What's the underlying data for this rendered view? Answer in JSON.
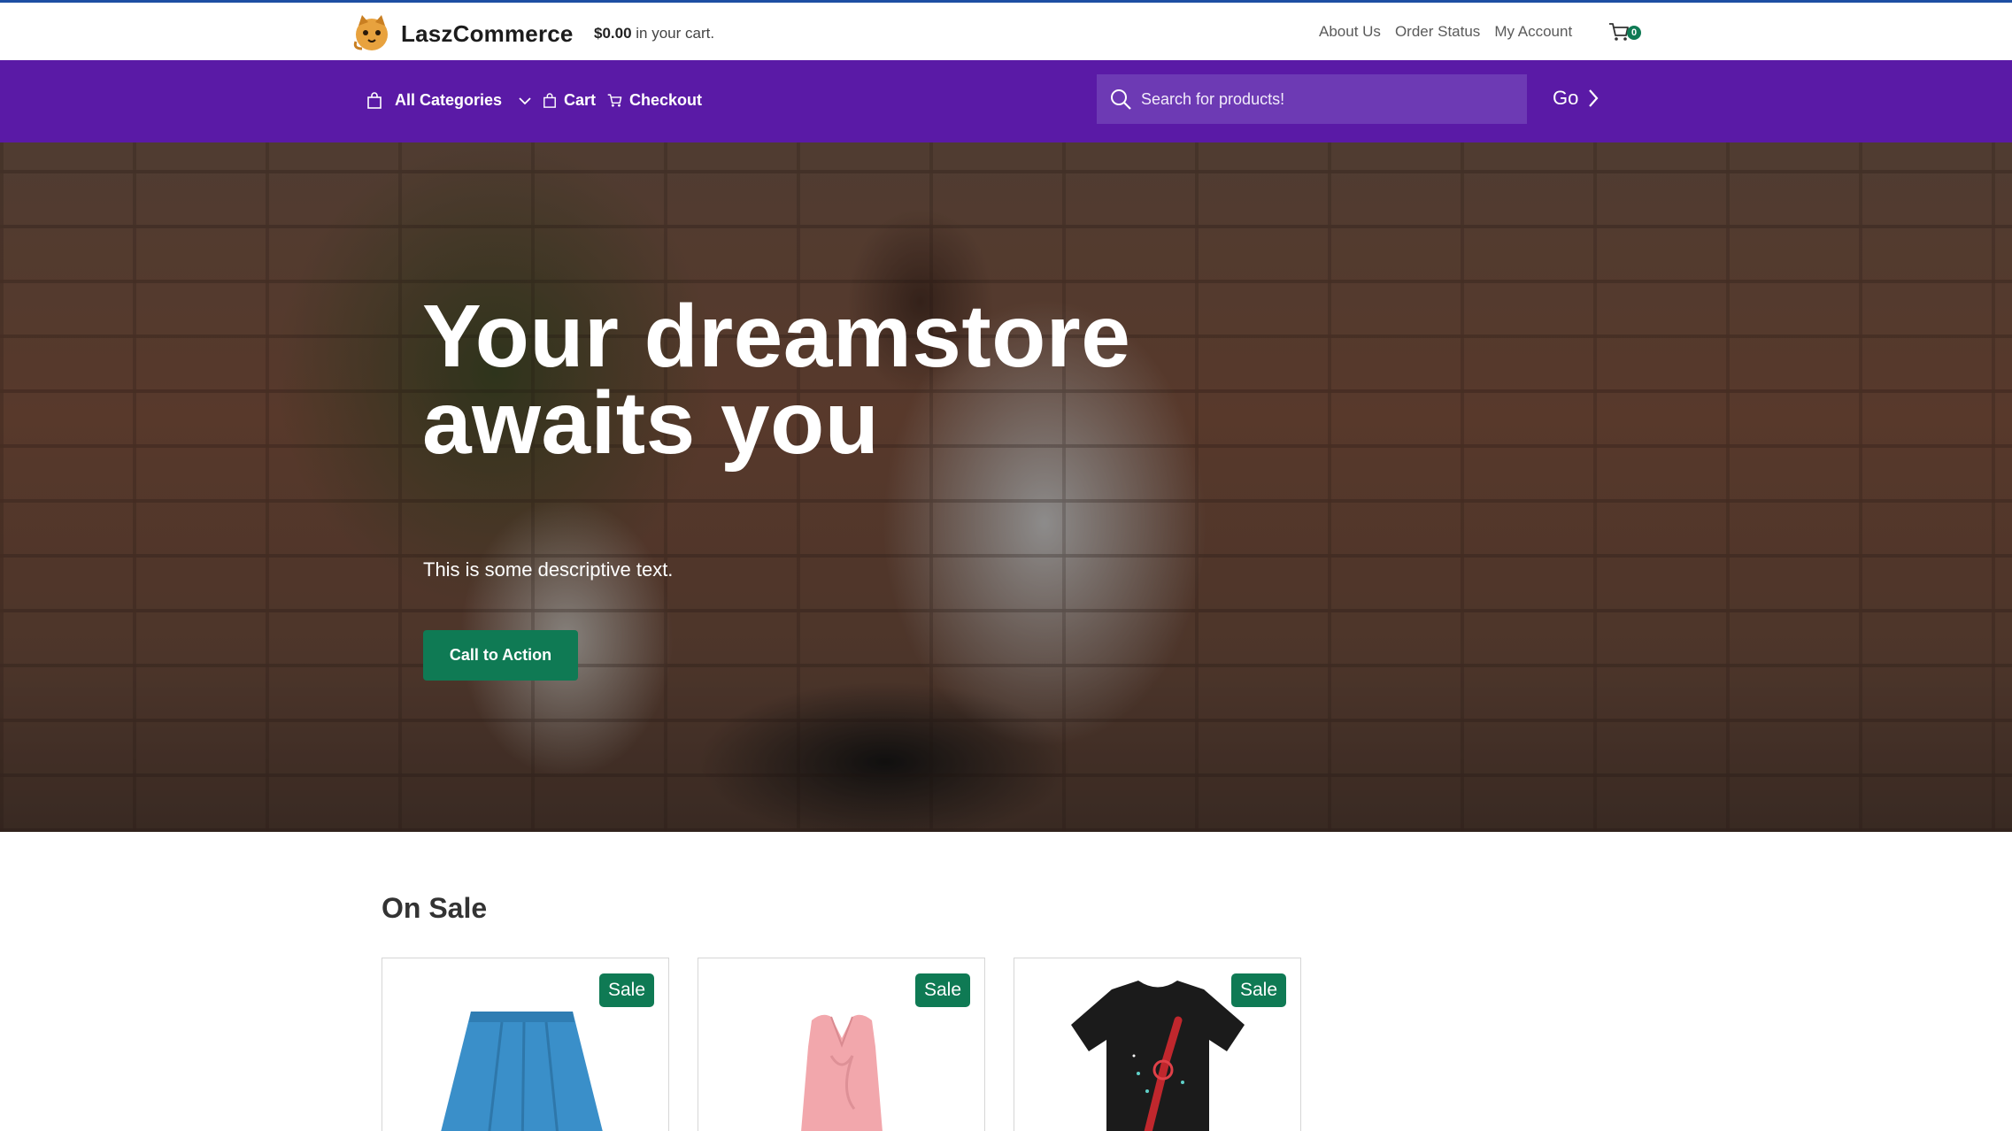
{
  "header": {
    "brand": "LaszCommerce",
    "cart_amount": "$0.00",
    "cart_suffix": " in your cart.",
    "links": [
      "About Us",
      "Order Status",
      "My Account"
    ],
    "cart_count": "0"
  },
  "nav": {
    "categories_label": "All Categories",
    "cart_label": "Cart",
    "checkout_label": "Checkout",
    "search_placeholder": "Search for products!",
    "go_label": "Go"
  },
  "hero": {
    "title_line1": "Your dreamstore",
    "title_line2": "awaits you",
    "description": "This is some descriptive text.",
    "cta_label": "Call to Action"
  },
  "on_sale": {
    "title": "On Sale",
    "products": [
      {
        "badge": "Sale",
        "image": "blue-skirt"
      },
      {
        "badge": "Sale",
        "image": "pink-sleeveless-blouse"
      },
      {
        "badge": "Sale",
        "image": "black-graphic-tshirt"
      }
    ]
  },
  "colors": {
    "accent_line": "#1d4fa3",
    "nav_purple": "#5a1aa6",
    "search_bg": "#6d3ab4",
    "action_green": "#0f7a54"
  }
}
